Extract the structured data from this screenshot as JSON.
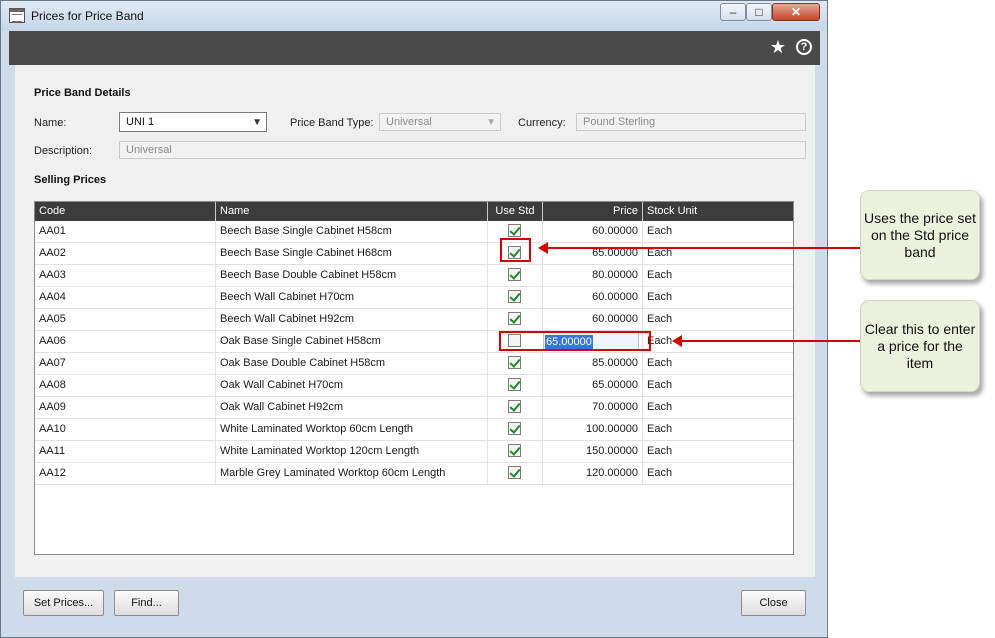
{
  "window": {
    "title": "Prices for Price Band"
  },
  "toolbar": {
    "favourite_icon": "star-icon",
    "help_icon": "help-icon",
    "help_glyph": "?"
  },
  "price_band_details": {
    "heading": "Price Band Details",
    "name_label": "Name:",
    "name_value": "UNI 1",
    "type_label": "Price Band Type:",
    "type_value": "Universal",
    "currency_label": "Currency:",
    "currency_value": "Pound Sterling",
    "description_label": "Description:",
    "description_value": "Universal"
  },
  "selling_prices": {
    "heading": "Selling Prices",
    "columns": {
      "code": "Code",
      "name": "Name",
      "use_std": "Use Std",
      "price": "Price",
      "stock_unit": "Stock Unit"
    },
    "rows": [
      {
        "code": "AA01",
        "name": "Beech Base Single Cabinet H58cm",
        "use_std": true,
        "price": "60.00000",
        "unit": "Each"
      },
      {
        "code": "AA02",
        "name": "Beech Base Single Cabinet H68cm",
        "use_std": true,
        "price": "65.00000",
        "unit": "Each"
      },
      {
        "code": "AA03",
        "name": "Beech Base Double Cabinet H58cm",
        "use_std": true,
        "price": "80.00000",
        "unit": "Each"
      },
      {
        "code": "AA04",
        "name": "Beech Wall Cabinet H70cm",
        "use_std": true,
        "price": "60.00000",
        "unit": "Each"
      },
      {
        "code": "AA05",
        "name": "Beech Wall Cabinet H92cm",
        "use_std": true,
        "price": "60.00000",
        "unit": "Each"
      },
      {
        "code": "AA06",
        "name": "Oak Base Single Cabinet H58cm",
        "use_std": false,
        "price": "65.00000",
        "unit": "Each"
      },
      {
        "code": "AA07",
        "name": "Oak Base Double Cabinet H58cm",
        "use_std": true,
        "price": "85.00000",
        "unit": "Each"
      },
      {
        "code": "AA08",
        "name": "Oak Wall Cabinet H70cm",
        "use_std": true,
        "price": "65.00000",
        "unit": "Each"
      },
      {
        "code": "AA09",
        "name": "Oak Wall Cabinet H92cm",
        "use_std": true,
        "price": "70.00000",
        "unit": "Each"
      },
      {
        "code": "AA10",
        "name": "White Laminated Worktop 60cm Length",
        "use_std": true,
        "price": "100.00000",
        "unit": "Each"
      },
      {
        "code": "AA11",
        "name": "White Laminated Worktop 120cm Length",
        "use_std": true,
        "price": "150.00000",
        "unit": "Each"
      },
      {
        "code": "AA12",
        "name": "Marble Grey Laminated Worktop 60cm Length",
        "use_std": true,
        "price": "120.00000",
        "unit": "Each"
      }
    ]
  },
  "footer": {
    "set_prices": "Set Prices...",
    "find": "Find...",
    "close": "Close"
  },
  "callouts": {
    "use_std": "Uses the price set on the Std price band",
    "clear": "Clear this to enter a price for the item"
  },
  "colors": {
    "annotation_red": "#d60000",
    "callout_bg": "#ecf1de",
    "header_dark": "#3c3c3c"
  }
}
